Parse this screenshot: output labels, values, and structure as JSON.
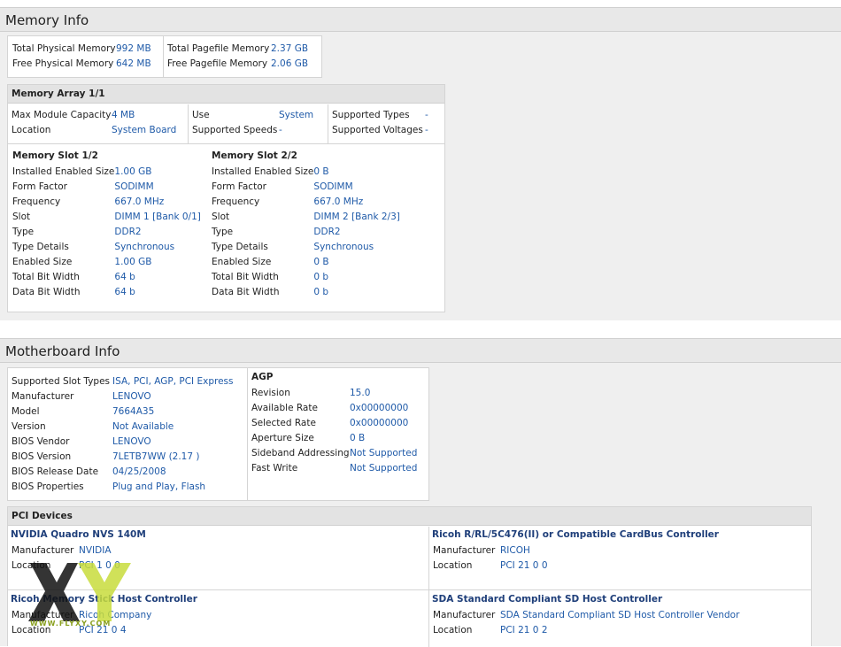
{
  "memory": {
    "title": "Memory Info",
    "summary_left": [
      {
        "k": "Total Physical Memory",
        "v": "992 MB"
      },
      {
        "k": "Free Physical Memory",
        "v": "642 MB"
      }
    ],
    "summary_right": [
      {
        "k": "Total Pagefile Memory",
        "v": "2.37 GB"
      },
      {
        "k": "Free Pagefile Memory",
        "v": "2.06 GB"
      }
    ],
    "array": {
      "title": "Memory Array 1/1",
      "col1": [
        {
          "k": "Max Module Capacity",
          "v": "4 MB"
        },
        {
          "k": "Location",
          "v": "System Board"
        }
      ],
      "col2": [
        {
          "k": "Use",
          "v": "System"
        },
        {
          "k": "Supported Speeds",
          "v": "-"
        }
      ],
      "col3": [
        {
          "k": "Supported Types",
          "v": "-"
        },
        {
          "k": "Supported Voltages",
          "v": "-"
        }
      ]
    },
    "slots": [
      {
        "title": "Memory Slot 1/2",
        "rows": [
          {
            "k": "Installed Enabled Size",
            "v": "1.00 GB"
          },
          {
            "k": "Form Factor",
            "v": "SODIMM"
          },
          {
            "k": "Frequency",
            "v": "667.0 MHz"
          },
          {
            "k": "Slot",
            "v": "DIMM 1 [Bank 0/1]"
          },
          {
            "k": "Type",
            "v": "DDR2"
          },
          {
            "k": "Type Details",
            "v": "Synchronous"
          },
          {
            "k": "Enabled Size",
            "v": "1.00 GB"
          },
          {
            "k": "Total Bit Width",
            "v": "64 b"
          },
          {
            "k": "Data Bit Width",
            "v": "64 b"
          }
        ]
      },
      {
        "title": "Memory Slot 2/2",
        "rows": [
          {
            "k": "Installed Enabled Size",
            "v": "0 B"
          },
          {
            "k": "Form Factor",
            "v": "SODIMM"
          },
          {
            "k": "Frequency",
            "v": "667.0 MHz"
          },
          {
            "k": "Slot",
            "v": "DIMM 2 [Bank 2/3]"
          },
          {
            "k": "Type",
            "v": "DDR2"
          },
          {
            "k": "Type Details",
            "v": "Synchronous"
          },
          {
            "k": "Enabled Size",
            "v": "0 B"
          },
          {
            "k": "Total Bit Width",
            "v": "0 b"
          },
          {
            "k": "Data Bit Width",
            "v": "0 b"
          }
        ]
      }
    ]
  },
  "motherboard": {
    "title": "Motherboard Info",
    "info": [
      {
        "k": "Supported Slot Types",
        "v": "ISA, PCI, AGP, PCI Express"
      },
      {
        "k": "Manufacturer",
        "v": "LENOVO"
      },
      {
        "k": "Model",
        "v": "7664A35"
      },
      {
        "k": "Version",
        "v": "Not Available"
      },
      {
        "k": "BIOS Vendor",
        "v": "LENOVO"
      },
      {
        "k": "BIOS Version",
        "v": "7LETB7WW (2.17 )"
      },
      {
        "k": "BIOS Release Date",
        "v": "04/25/2008"
      },
      {
        "k": "BIOS Properties",
        "v": "Plug and Play, Flash"
      }
    ],
    "agp": {
      "title": "AGP",
      "rows": [
        {
          "k": "Revision",
          "v": "15.0"
        },
        {
          "k": "Available Rate",
          "v": "0x00000000"
        },
        {
          "k": "Selected Rate",
          "v": "0x00000000"
        },
        {
          "k": "Aperture Size",
          "v": "0 B"
        },
        {
          "k": "Sideband Addressing",
          "v": "Not Supported"
        },
        {
          "k": "Fast Write",
          "v": "Not Supported"
        }
      ]
    },
    "pci": {
      "title": "PCI Devices",
      "devices": [
        {
          "name": "NVIDIA Quadro NVS 140M",
          "rows": [
            {
              "k": "Manufacturer",
              "v": "NVIDIA"
            },
            {
              "k": "Location",
              "v": "PCI 1 0 0"
            }
          ]
        },
        {
          "name": "Ricoh R/RL/5C476(II) or Compatible CardBus Controller",
          "rows": [
            {
              "k": "Manufacturer",
              "v": "RICOH"
            },
            {
              "k": "Location",
              "v": "PCI 21 0 0"
            }
          ]
        },
        {
          "name": "Ricoh Memory Stick Host Controller",
          "rows": [
            {
              "k": "Manufacturer",
              "v": "Ricoh Company"
            },
            {
              "k": "Location",
              "v": "PCI 21 0 4"
            }
          ]
        },
        {
          "name": "SDA Standard Compliant SD Host Controller",
          "rows": [
            {
              "k": "Manufacturer",
              "v": "SDA Standard Compliant SD Host Controller Vendor"
            },
            {
              "k": "Location",
              "v": "PCI 21 0 2"
            }
          ]
        }
      ]
    }
  },
  "watermark": {
    "text": "XY",
    "site": "WWW.FLYXY.COM"
  }
}
